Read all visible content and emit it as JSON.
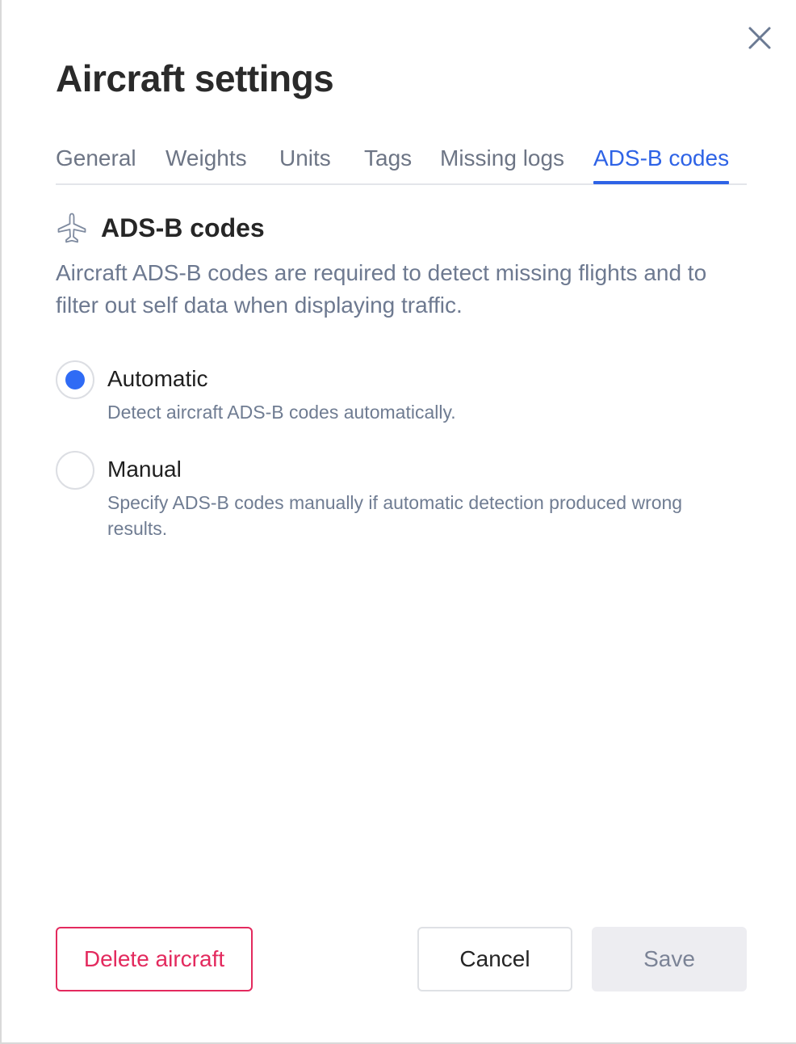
{
  "dialog": {
    "title": "Aircraft settings",
    "close_icon": "close-icon"
  },
  "tabs": [
    {
      "label": "General",
      "active": false
    },
    {
      "label": "Weights",
      "active": false
    },
    {
      "label": "Units",
      "active": false
    },
    {
      "label": "Tags",
      "active": false
    },
    {
      "label": "Missing logs",
      "active": false
    },
    {
      "label": "ADS-B codes",
      "active": true
    }
  ],
  "section": {
    "icon": "airplane-icon",
    "title": "ADS-B codes",
    "description": "Aircraft ADS-B codes are required to detect missing flights and to filter out self data when displaying traffic."
  },
  "options": [
    {
      "label": "Automatic",
      "description": "Detect aircraft ADS-B codes automatically.",
      "checked": true
    },
    {
      "label": "Manual",
      "description": "Specify ADS-B codes manually if automatic detection produced wrong results.",
      "checked": false
    }
  ],
  "footer": {
    "delete_label": "Delete aircraft",
    "cancel_label": "Cancel",
    "save_label": "Save"
  },
  "colors": {
    "accent": "#2e63e6",
    "danger": "#e32a5e",
    "radio_checked": "#2f6bf5",
    "disabled_bg": "#ededf1"
  }
}
